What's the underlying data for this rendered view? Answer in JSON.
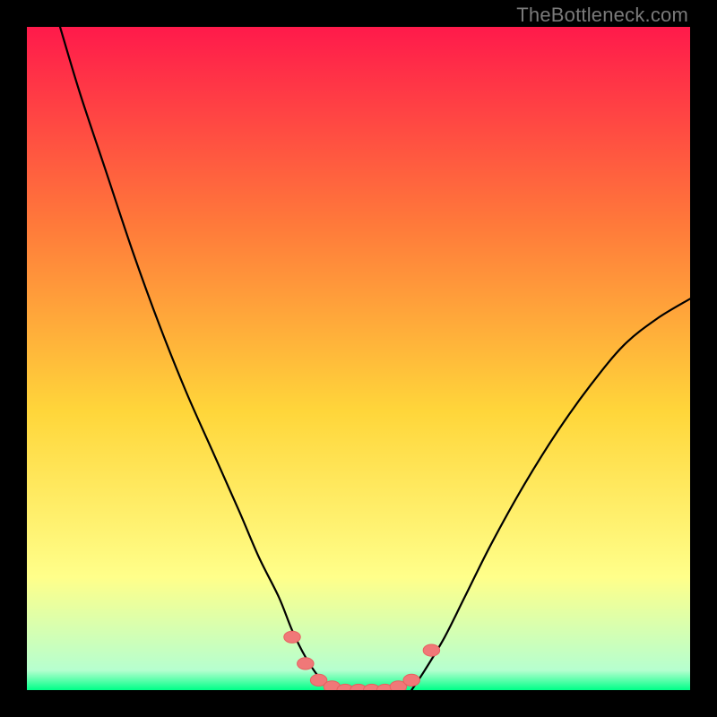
{
  "watermark": "TheBottleneck.com",
  "colors": {
    "gradient_top": "#ff1a4b",
    "gradient_mid_upper": "#ff7a3a",
    "gradient_mid": "#ffd63a",
    "gradient_lower": "#ffff8a",
    "gradient_bottom": "#00ff88",
    "curve": "#000000",
    "marker": "#f07878",
    "frame": "#000000"
  },
  "chart_data": {
    "type": "line",
    "title": "",
    "xlabel": "",
    "ylabel": "",
    "xlim": [
      0,
      100
    ],
    "ylim": [
      0,
      100
    ],
    "grid": false,
    "legend": false,
    "series": [
      {
        "name": "left-curve",
        "x": [
          5,
          8,
          12,
          16,
          20,
          24,
          28,
          32,
          35,
          38,
          40,
          42,
          44,
          46
        ],
        "y": [
          100,
          90,
          78,
          66,
          55,
          45,
          36,
          27,
          20,
          14,
          9,
          5,
          2,
          0
        ]
      },
      {
        "name": "right-curve",
        "x": [
          58,
          60,
          63,
          66,
          70,
          75,
          80,
          85,
          90,
          95,
          100
        ],
        "y": [
          0,
          3,
          8,
          14,
          22,
          31,
          39,
          46,
          52,
          56,
          59
        ]
      }
    ],
    "markers": {
      "name": "bottom-markers",
      "points": [
        {
          "x": 40,
          "y": 8
        },
        {
          "x": 42,
          "y": 4
        },
        {
          "x": 44,
          "y": 1.5
        },
        {
          "x": 46,
          "y": 0.5
        },
        {
          "x": 48,
          "y": 0
        },
        {
          "x": 50,
          "y": 0
        },
        {
          "x": 52,
          "y": 0
        },
        {
          "x": 54,
          "y": 0
        },
        {
          "x": 56,
          "y": 0.5
        },
        {
          "x": 58,
          "y": 1.5
        },
        {
          "x": 61,
          "y": 6
        }
      ],
      "radius": 2.2
    }
  }
}
